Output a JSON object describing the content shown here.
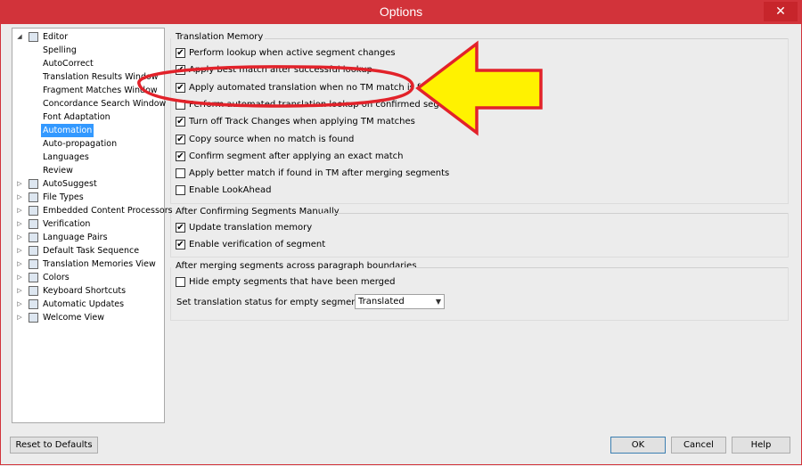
{
  "window": {
    "title": "Options",
    "close_symbol": "✕"
  },
  "tree": {
    "items": [
      {
        "label": "Editor",
        "toggle": "◢",
        "icon": "pencil-icon",
        "level": 0
      },
      {
        "label": "Spelling",
        "level": 1
      },
      {
        "label": "AutoCorrect",
        "level": 1
      },
      {
        "label": "Translation Results Window",
        "level": 1
      },
      {
        "label": "Fragment Matches Window",
        "level": 1
      },
      {
        "label": "Concordance Search Window",
        "level": 1
      },
      {
        "label": "Font Adaptation",
        "level": 1
      },
      {
        "label": "Automation",
        "level": 1,
        "selected": true
      },
      {
        "label": "Auto-propagation",
        "level": 1
      },
      {
        "label": "Languages",
        "level": 1
      },
      {
        "label": "Review",
        "level": 1
      },
      {
        "label": "AutoSuggest",
        "toggle": "▷",
        "icon": "autosuggest-icon",
        "level": 0
      },
      {
        "label": "File Types",
        "toggle": "▷",
        "icon": "file-types-icon",
        "level": 0
      },
      {
        "label": "Embedded Content Processors",
        "toggle": "▷",
        "icon": "embedded-content-icon",
        "level": 0
      },
      {
        "label": "Verification",
        "toggle": "▷",
        "icon": "verification-icon",
        "level": 0
      },
      {
        "label": "Language Pairs",
        "toggle": "▷",
        "icon": "language-pairs-icon",
        "level": 0
      },
      {
        "label": "Default Task Sequence",
        "toggle": "▷",
        "icon": "task-sequence-icon",
        "level": 0
      },
      {
        "label": "Translation Memories View",
        "toggle": "▷",
        "icon": "translation-memories-icon",
        "level": 0
      },
      {
        "label": "Colors",
        "toggle": "▷",
        "icon": "colors-icon",
        "level": 0
      },
      {
        "label": "Keyboard Shortcuts",
        "toggle": "▷",
        "icon": "keyboard-icon",
        "level": 0
      },
      {
        "label": "Automatic Updates",
        "toggle": "▷",
        "icon": "updates-icon",
        "level": 0
      },
      {
        "label": "Welcome View",
        "toggle": "▷",
        "icon": "home-icon",
        "level": 0
      }
    ]
  },
  "tm_group": {
    "title": "Translation Memory",
    "options": [
      {
        "label": "Perform lookup when active segment changes",
        "checked": true
      },
      {
        "label": "Apply best match after successful lookup",
        "checked": true
      },
      {
        "label": "Apply automated translation when no TM match is found",
        "checked": true
      },
      {
        "label": "Perform automated translation lookup on confirmed segments",
        "checked": false
      },
      {
        "label": "Turn off Track Changes when applying TM matches",
        "checked": true
      },
      {
        "label": "Copy source when no match is found",
        "checked": true
      },
      {
        "label": "Confirm segment after applying an exact match",
        "checked": true
      },
      {
        "label": "Apply better match if found in TM after merging segments",
        "checked": false
      },
      {
        "label": "Enable LookAhead",
        "checked": false
      }
    ]
  },
  "confirm_group": {
    "title": "After Confirming Segments Manually",
    "options": [
      {
        "label": "Update translation memory",
        "checked": true
      },
      {
        "label": "Enable verification of segment",
        "checked": true
      }
    ]
  },
  "merge_group": {
    "title": "After merging segments across paragraph boundaries",
    "options": [
      {
        "label": "Hide empty segments that have been merged",
        "checked": false
      }
    ],
    "status_label": "Set translation status for empty segments to:",
    "status_value": "Translated"
  },
  "buttons": {
    "reset": "Reset to Defaults",
    "ok": "OK",
    "cancel": "Cancel",
    "help": "Help"
  },
  "check_symbol": "✔",
  "colors": {
    "titlebar": "#d2333a",
    "annotation_red": "#e2222a",
    "arrow_yellow": "#fff200",
    "selection": "#3399ff"
  }
}
